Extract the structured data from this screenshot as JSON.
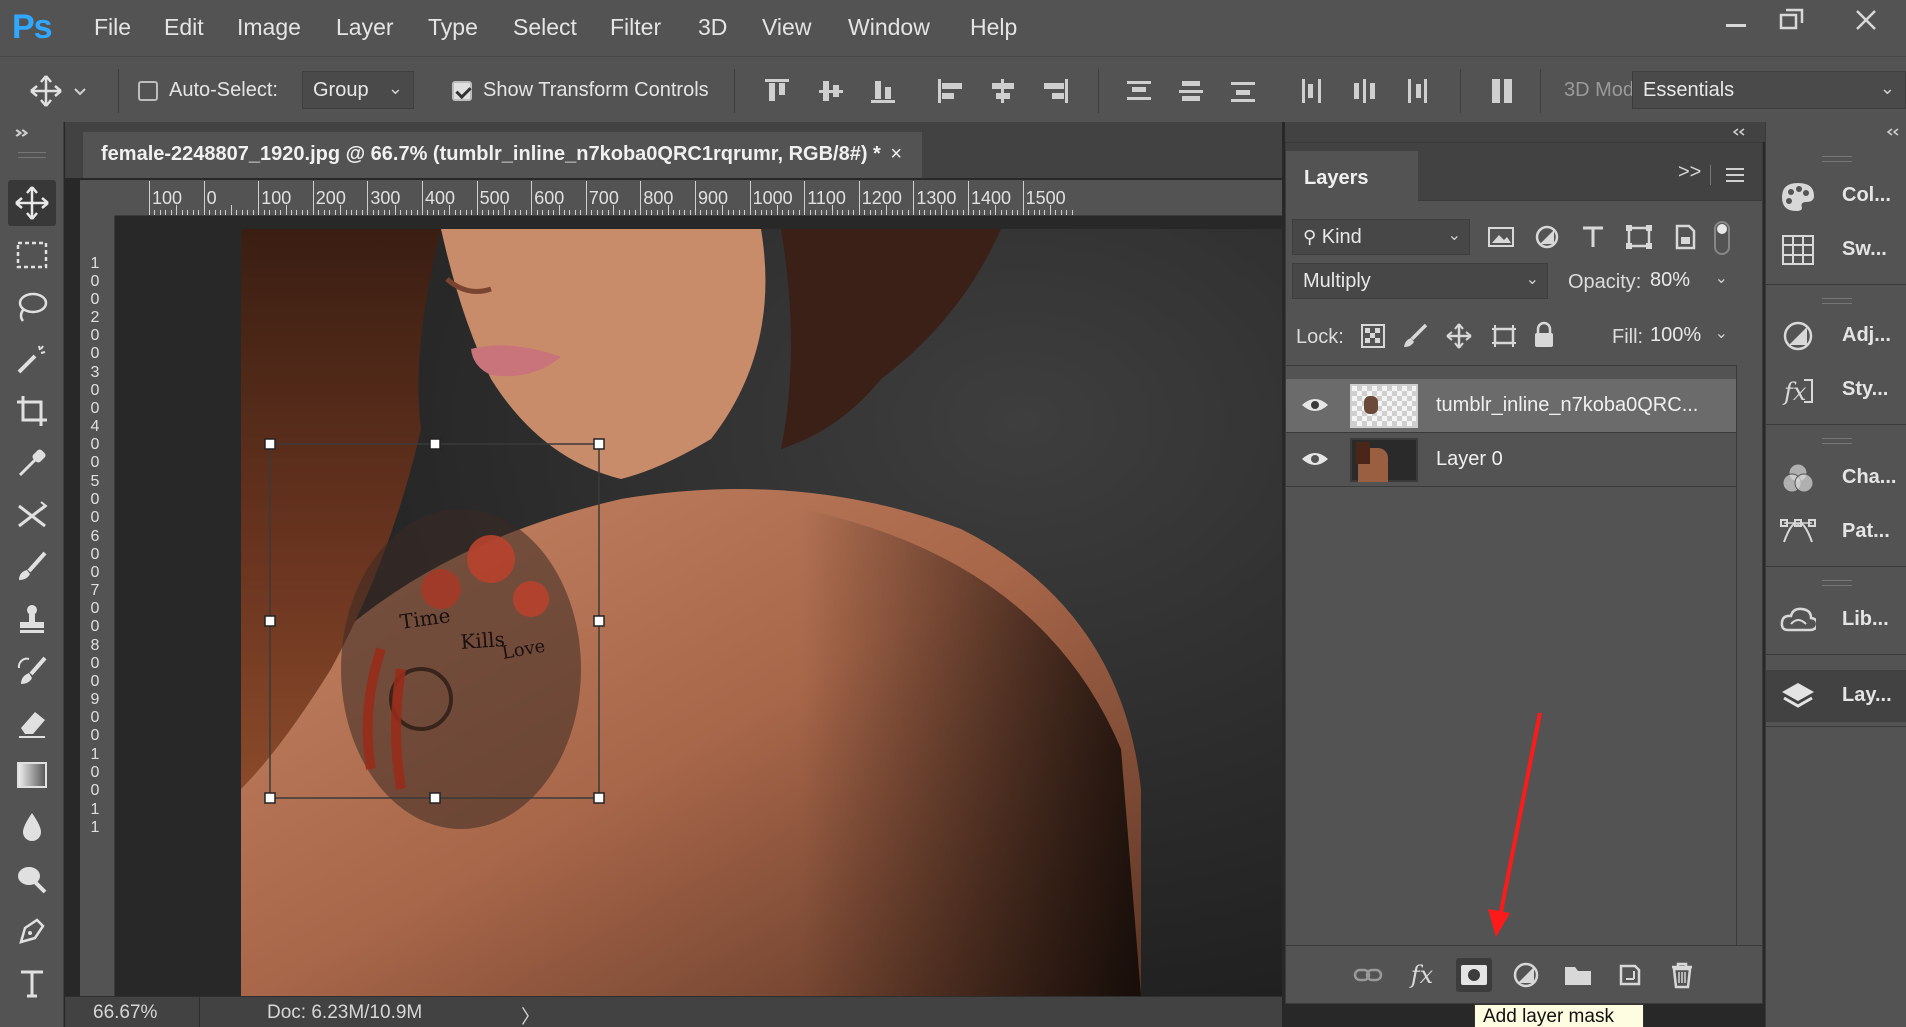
{
  "menubar": {
    "logo": "Ps",
    "items": [
      "File",
      "Edit",
      "Image",
      "Layer",
      "Type",
      "Select",
      "Filter",
      "3D",
      "View",
      "Window",
      "Help"
    ],
    "window_controls": [
      "minimize-icon",
      "restore-icon",
      "close-icon"
    ]
  },
  "options": {
    "auto_select_label": "Auto-Select:",
    "auto_select_checked": false,
    "auto_select_target": "Group",
    "show_transform_label": "Show Transform Controls",
    "show_transform_checked": true,
    "mode_3d_label": "3D Mod",
    "workspace": "Essentials"
  },
  "document": {
    "tab_title": "female-2248807_1920.jpg @ 66.7% (tumblr_inline_n7koba0QRC1rqrumr, RGB/8#) *",
    "close_glyph": "×",
    "ruler_top_labels": [
      "100",
      "0",
      "100",
      "200",
      "300",
      "400",
      "500",
      "600",
      "700",
      "800",
      "900",
      "1000",
      "1100",
      "1200",
      "1300",
      "1400",
      "1500"
    ],
    "ruler_left_labels": [
      "0",
      "100",
      "200",
      "300",
      "400",
      "500",
      "600",
      "700",
      "800",
      "900",
      "100",
      "11"
    ],
    "transform_text": [
      "Time",
      "Kills",
      "Love"
    ]
  },
  "status": {
    "zoom": "66.67%",
    "doc_size": "Doc: 6.23M/10.9M",
    "more_glyph": "〉"
  },
  "layers_panel": {
    "title": "Layers",
    "expand_glyph": ">>",
    "filter_kind": "Kind",
    "blend_mode": "Multiply",
    "opacity_label": "Opacity:",
    "opacity_value": "80%",
    "lock_label": "Lock:",
    "fill_label": "Fill:",
    "fill_value": "100%",
    "layers": [
      {
        "name": "tumblr_inline_n7koba0QRC...",
        "visible": true,
        "selected": true
      },
      {
        "name": "Layer 0",
        "visible": true,
        "selected": false
      }
    ],
    "footer_tooltip": "Add layer mask"
  },
  "dock": {
    "items": [
      {
        "icon": "color-icon",
        "label": "Col..."
      },
      {
        "icon": "swatches-icon",
        "label": "Sw..."
      },
      {
        "icon": "adjustments-icon",
        "label": "Adj..."
      },
      {
        "icon": "styles-icon",
        "label": "Sty..."
      },
      {
        "icon": "channels-icon",
        "label": "Cha..."
      },
      {
        "icon": "paths-icon",
        "label": "Pat..."
      },
      {
        "icon": "libraries-icon",
        "label": "Lib..."
      },
      {
        "icon": "layers-icon",
        "label": "Lay..."
      }
    ]
  },
  "colors": {
    "ui_bg": "#535353",
    "ui_dark": "#424242",
    "canvas_bg": "#282828",
    "ps_blue": "#31a8ff",
    "annotation_arrow": "#ff1a1a"
  }
}
